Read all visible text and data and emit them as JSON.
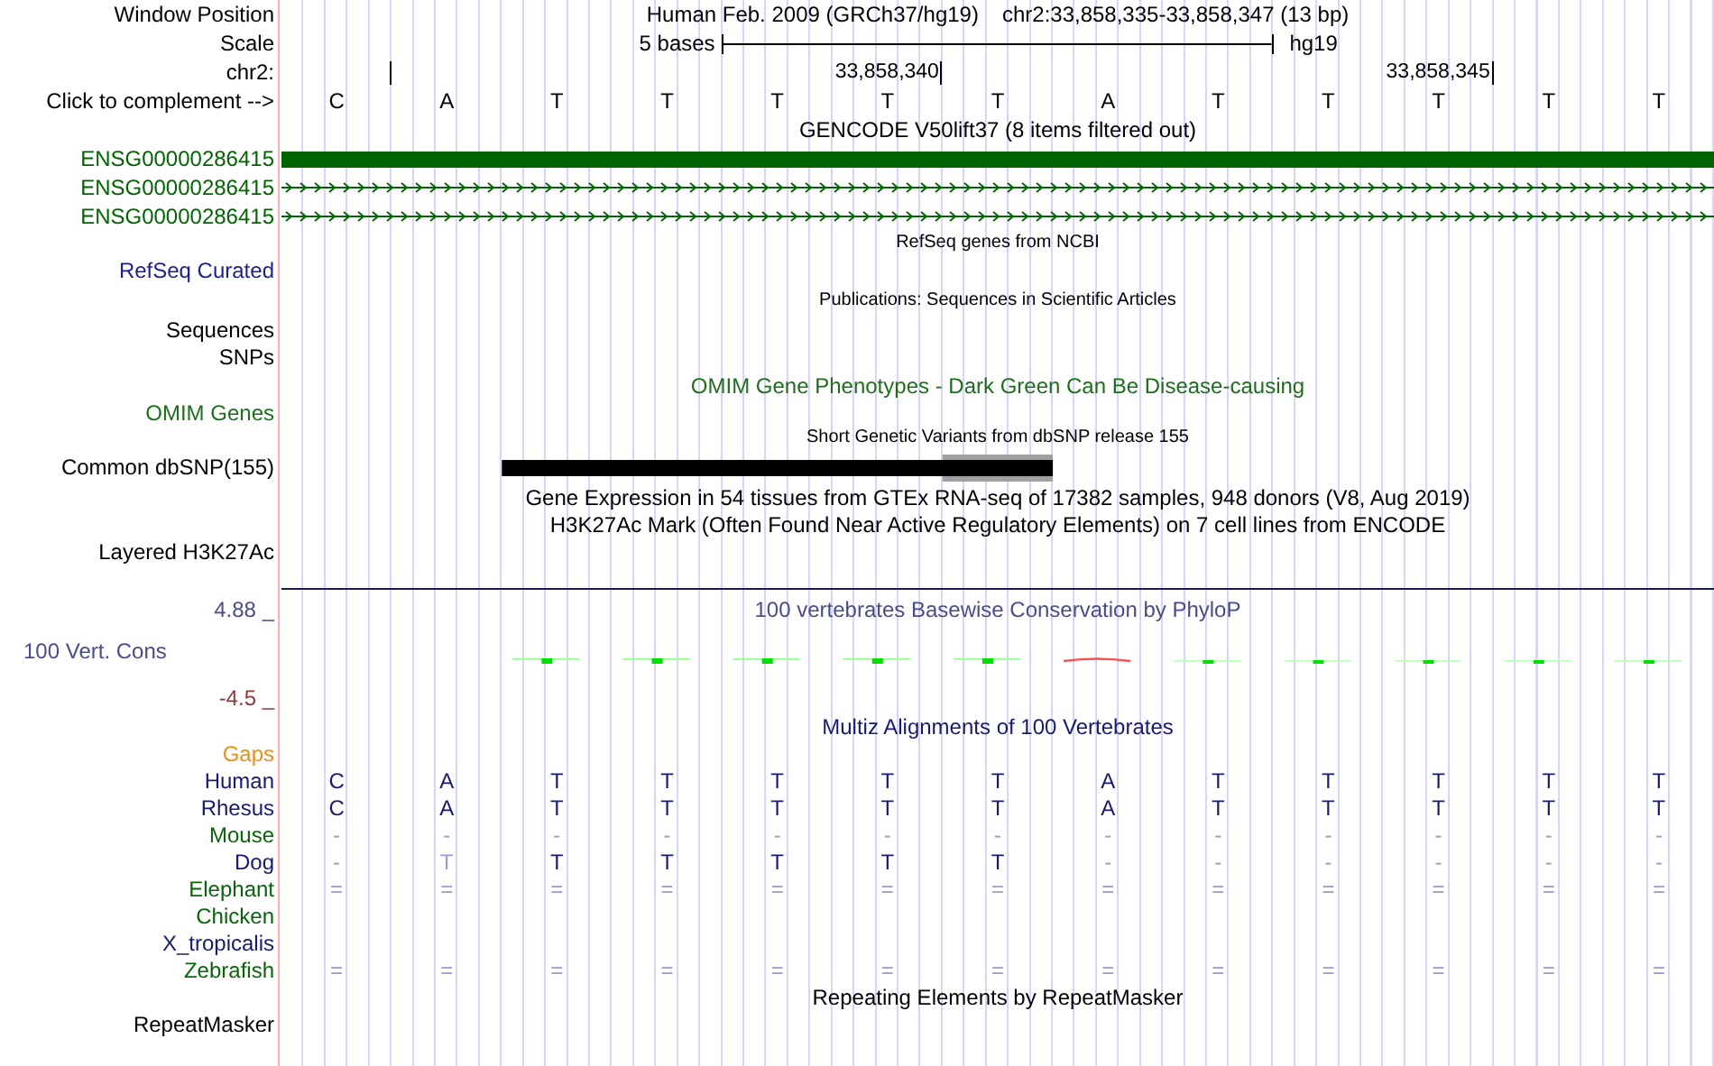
{
  "header": {
    "window_position_label": "Window Position",
    "assembly": "Human Feb. 2009 (GRCh37/hg19)",
    "position": "chr2:33,858,335-33,858,347 (13 bp)",
    "scale_label": "Scale",
    "scale_text": "5 bases",
    "scale_assembly": "hg19",
    "chrom_label": "chr2:",
    "ticks": [
      "33,858,340",
      "33,858,345"
    ],
    "complement_label": "Click to complement -->",
    "bases": [
      "C",
      "A",
      "T",
      "T",
      "T",
      "T",
      "T",
      "A",
      "T",
      "T",
      "T",
      "T",
      "T"
    ]
  },
  "gencode": {
    "title": "GENCODE V50lift37 (8 items filtered out)",
    "genes": [
      {
        "name": "ENSG00000286415",
        "kind": "block"
      },
      {
        "name": "ENSG00000286415",
        "kind": "arrows"
      },
      {
        "name": "ENSG00000286415",
        "kind": "arrows"
      }
    ]
  },
  "refseq": {
    "title": "RefSeq genes from NCBI",
    "label": "RefSeq Curated"
  },
  "publications": {
    "title": "Publications: Sequences in Scientific Articles",
    "labels": [
      "Sequences",
      "SNPs"
    ]
  },
  "omim": {
    "title": "OMIM Gene Phenotypes - Dark Green Can Be Disease-causing",
    "label": "OMIM Genes"
  },
  "dbsnp": {
    "title": "Short Genetic Variants from dbSNP release 155",
    "label": "Common dbSNP(155)"
  },
  "gtex": {
    "title": "Gene Expression in 54 tissues from GTEx RNA-seq of 17382 samples, 948 donors (V8, Aug 2019)"
  },
  "h3k27ac": {
    "title": "H3K27Ac Mark (Often Found Near Active Regulatory Elements) on 7 cell lines from ENCODE",
    "label": "Layered H3K27Ac"
  },
  "phylop": {
    "title": "100 vertebrates Basewise Conservation by PhyloP",
    "label": "100 Vert. Cons",
    "max": "4.88 _",
    "min": "-4.5 _"
  },
  "multiz": {
    "title": "Multiz Alignments of 100 Vertebrates",
    "gaps_label": "Gaps",
    "species": [
      {
        "name": "Human",
        "color": "#191970",
        "cells": [
          {
            "t": "C",
            "faint": false
          },
          {
            "t": "A",
            "faint": false
          },
          {
            "t": "T",
            "faint": false
          },
          {
            "t": "T",
            "faint": false
          },
          {
            "t": "T",
            "faint": false
          },
          {
            "t": "T",
            "faint": false
          },
          {
            "t": "T",
            "faint": false
          },
          {
            "t": "A",
            "faint": false
          },
          {
            "t": "T",
            "faint": false
          },
          {
            "t": "T",
            "faint": false
          },
          {
            "t": "T",
            "faint": false
          },
          {
            "t": "T",
            "faint": false
          },
          {
            "t": "T",
            "faint": false
          }
        ]
      },
      {
        "name": "Rhesus",
        "color": "#191970",
        "cells": [
          {
            "t": "C",
            "faint": false
          },
          {
            "t": "A",
            "faint": false
          },
          {
            "t": "T",
            "faint": false
          },
          {
            "t": "T",
            "faint": false
          },
          {
            "t": "T",
            "faint": false
          },
          {
            "t": "T",
            "faint": false
          },
          {
            "t": "T",
            "faint": false
          },
          {
            "t": "A",
            "faint": false
          },
          {
            "t": "T",
            "faint": false
          },
          {
            "t": "T",
            "faint": false
          },
          {
            "t": "T",
            "faint": false
          },
          {
            "t": "T",
            "faint": false
          },
          {
            "t": "T",
            "faint": false
          }
        ]
      },
      {
        "name": "Mouse",
        "color": "#0a640a",
        "cells": [
          {
            "t": "-",
            "faint": true
          },
          {
            "t": "-",
            "faint": true
          },
          {
            "t": "-",
            "faint": true
          },
          {
            "t": "-",
            "faint": true
          },
          {
            "t": "-",
            "faint": true
          },
          {
            "t": "-",
            "faint": true
          },
          {
            "t": "-",
            "faint": true
          },
          {
            "t": "-",
            "faint": true
          },
          {
            "t": "-",
            "faint": true
          },
          {
            "t": "-",
            "faint": true
          },
          {
            "t": "-",
            "faint": true
          },
          {
            "t": "-",
            "faint": true
          },
          {
            "t": "-",
            "faint": true
          }
        ]
      },
      {
        "name": "Dog",
        "color": "#191970",
        "cells": [
          {
            "t": "-",
            "faint": true
          },
          {
            "t": "T",
            "faint": true
          },
          {
            "t": "T",
            "faint": false
          },
          {
            "t": "T",
            "faint": false
          },
          {
            "t": "T",
            "faint": false
          },
          {
            "t": "T",
            "faint": false
          },
          {
            "t": "T",
            "faint": false
          },
          {
            "t": "-",
            "faint": true
          },
          {
            "t": "-",
            "faint": true
          },
          {
            "t": "-",
            "faint": true
          },
          {
            "t": "-",
            "faint": true
          },
          {
            "t": "-",
            "faint": true
          },
          {
            "t": "-",
            "faint": true
          }
        ]
      },
      {
        "name": "Elephant",
        "color": "#0a640a",
        "cells": [
          {
            "t": "=",
            "faint": true
          },
          {
            "t": "=",
            "faint": true
          },
          {
            "t": "=",
            "faint": true
          },
          {
            "t": "=",
            "faint": true
          },
          {
            "t": "=",
            "faint": true
          },
          {
            "t": "=",
            "faint": true
          },
          {
            "t": "=",
            "faint": true
          },
          {
            "t": "=",
            "faint": true
          },
          {
            "t": "=",
            "faint": true
          },
          {
            "t": "=",
            "faint": true
          },
          {
            "t": "=",
            "faint": true
          },
          {
            "t": "=",
            "faint": true
          },
          {
            "t": "=",
            "faint": true
          }
        ]
      },
      {
        "name": "Chicken",
        "color": "#0a640a"
      },
      {
        "name": "X_tropicalis",
        "color": "#191970"
      },
      {
        "name": "Zebrafish",
        "color": "#0a640a",
        "cells": [
          {
            "t": "=",
            "faint": true
          },
          {
            "t": "=",
            "faint": true
          },
          {
            "t": "=",
            "faint": true
          },
          {
            "t": "=",
            "faint": true
          },
          {
            "t": "=",
            "faint": true
          },
          {
            "t": "=",
            "faint": true
          },
          {
            "t": "=",
            "faint": true
          },
          {
            "t": "=",
            "faint": true
          },
          {
            "t": "=",
            "faint": true
          },
          {
            "t": "=",
            "faint": true
          },
          {
            "t": "=",
            "faint": true
          },
          {
            "t": "=",
            "faint": true
          },
          {
            "t": "=",
            "faint": true
          }
        ]
      }
    ]
  },
  "repeatmasker": {
    "title": "Repeating Elements by RepeatMasker",
    "label": "RepeatMasker"
  }
}
